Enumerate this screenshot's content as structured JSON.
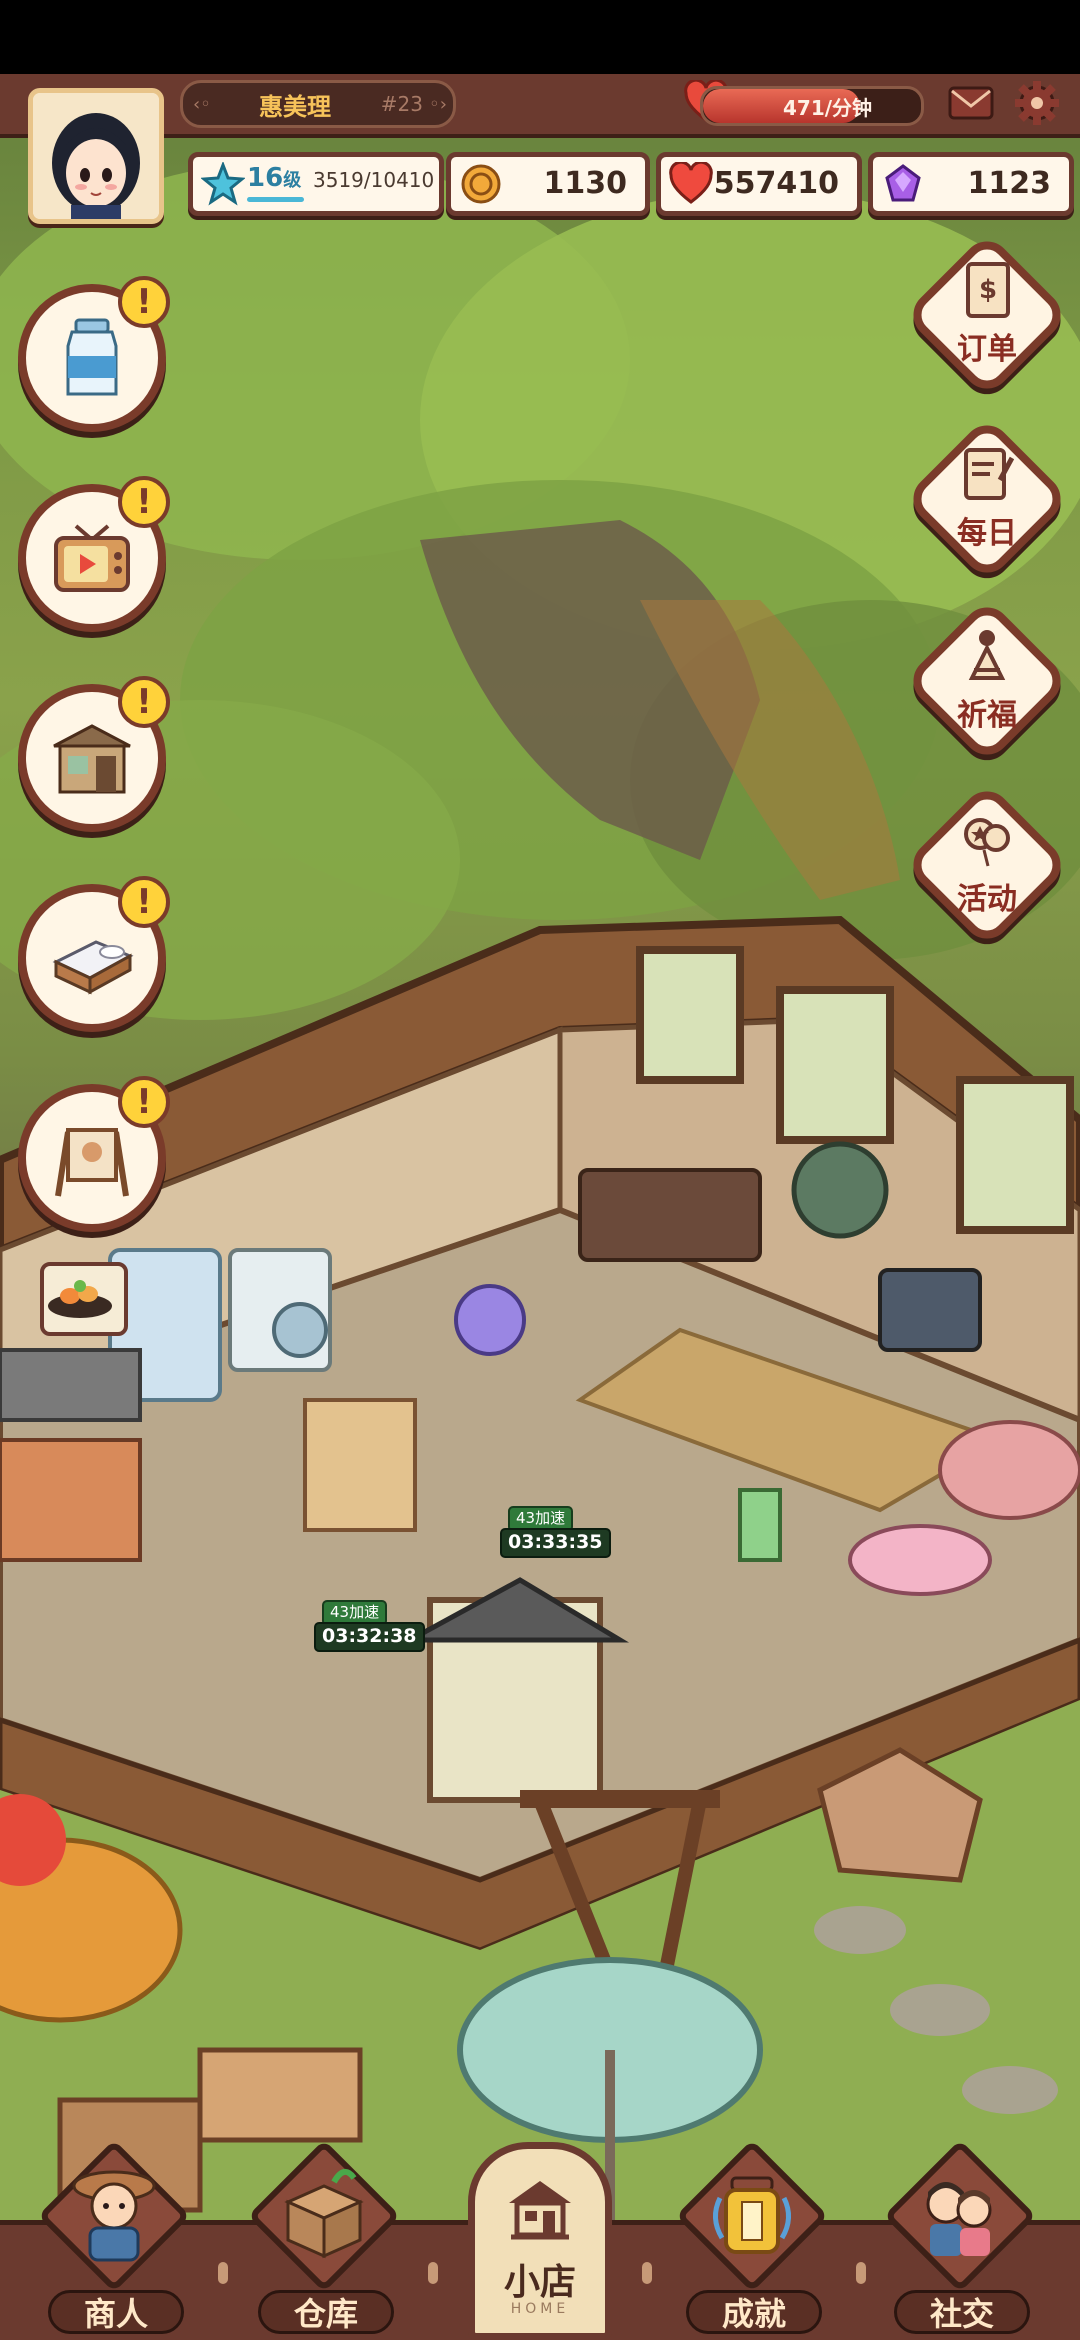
{
  "player": {
    "name": "惠美理",
    "rank": "#23",
    "level_num": "16",
    "level_unit": "级",
    "exp": "3519/10410",
    "exp_progress": 0.338
  },
  "stamina": {
    "text": "471/分钟",
    "fill": 0.72
  },
  "resources": {
    "coins": "1130",
    "hearts": "557410",
    "gems": "1123"
  },
  "left_buttons": [
    {
      "name": "milk-bottle",
      "alert": "!"
    },
    {
      "name": "tv-ad",
      "alert": "!"
    },
    {
      "name": "shop-building",
      "alert": "!"
    },
    {
      "name": "bed",
      "alert": "!"
    },
    {
      "name": "signboard",
      "alert": "!"
    }
  ],
  "right_buttons": {
    "orders": "订单",
    "daily": "每日",
    "pray": "祈福",
    "events": "活动"
  },
  "timers": [
    {
      "badge": "43加速",
      "time": "03:33:35"
    },
    {
      "badge": "43加速",
      "time": "03:32:38"
    }
  ],
  "bottom_nav": {
    "merchant": "商人",
    "warehouse": "仓库",
    "shop": "小店",
    "shop_sub": "HOME",
    "achievements": "成就",
    "social": "社交"
  },
  "colors": {
    "frame": "#6b3a2f",
    "accent_text": "#8a2d22",
    "alert": "#ffd23a",
    "timer_green": "#2f7a3a"
  }
}
